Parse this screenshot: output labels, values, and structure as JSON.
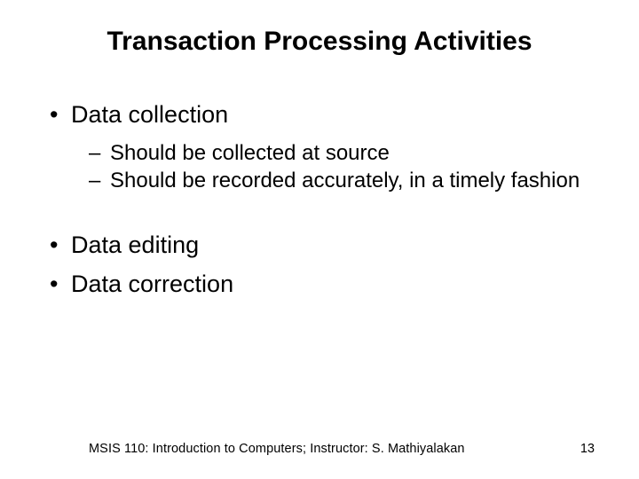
{
  "slide": {
    "title": "Transaction Processing Activities",
    "bullets": [
      {
        "level": 1,
        "text": "Data collection"
      },
      {
        "level": 2,
        "text": "Should be collected at source"
      },
      {
        "level": 2,
        "text": "Should be recorded accurately, in a timely fashion"
      },
      {
        "level": 1,
        "text": "Data editing"
      },
      {
        "level": 1,
        "text": "Data correction"
      }
    ],
    "footer": {
      "text": "MSIS 110:  Introduction to Computers;  Instructor: S. Mathiyalakan",
      "page": "13"
    }
  }
}
